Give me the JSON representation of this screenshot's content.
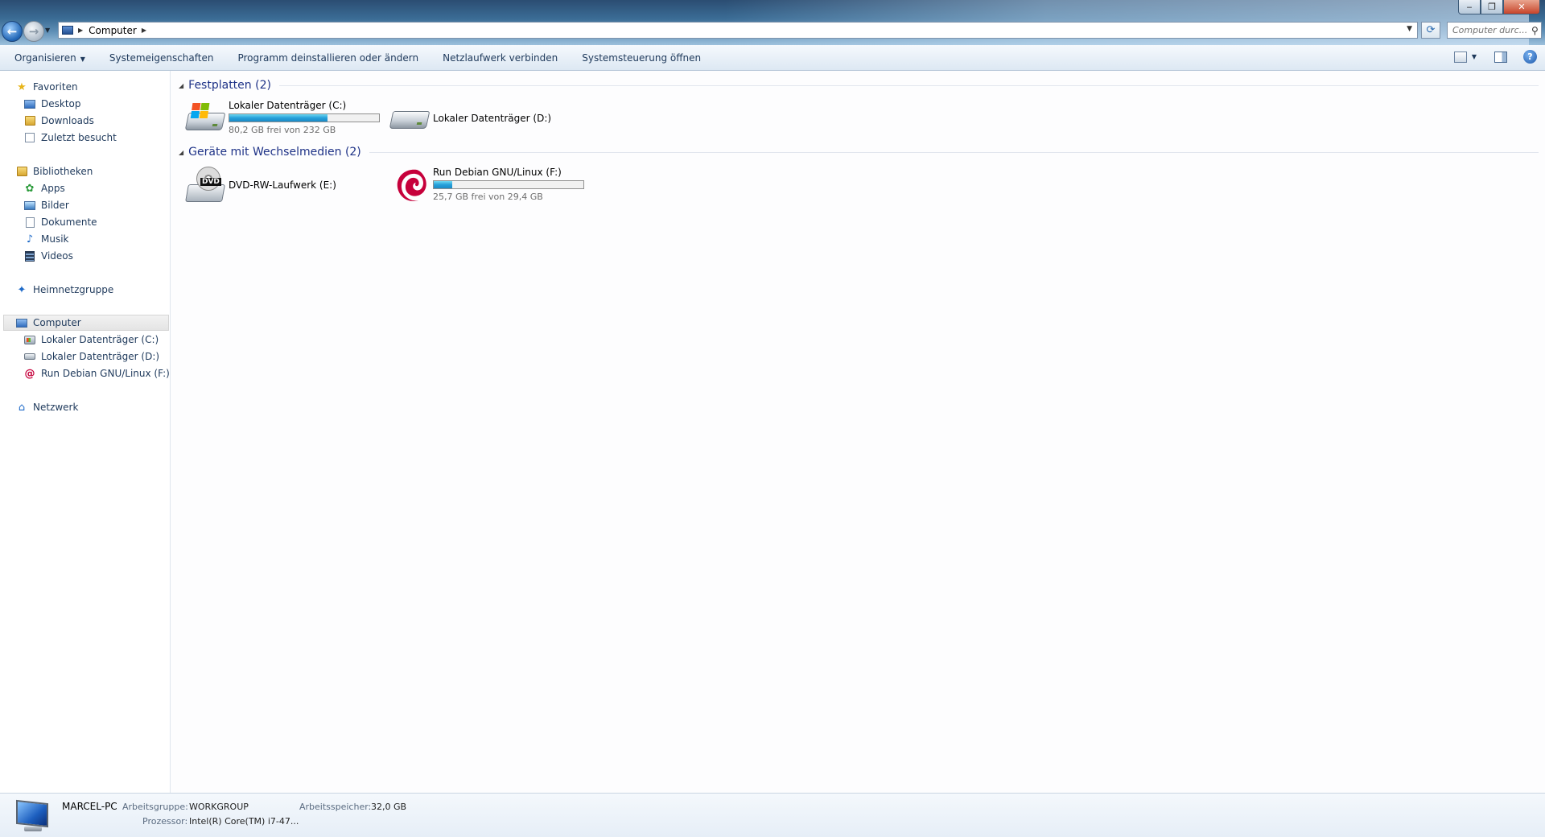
{
  "address": {
    "crumb": "Computer",
    "search_placeholder": "Computer durc..."
  },
  "toolbar": {
    "organize": "Organisieren",
    "system_properties": "Systemeigenschaften",
    "uninstall": "Programm deinstallieren oder ändern",
    "map_drive": "Netzlaufwerk verbinden",
    "control_panel": "Systemsteuerung öffnen"
  },
  "sidebar": {
    "favorites": {
      "label": "Favoriten",
      "items": [
        "Desktop",
        "Downloads",
        "Zuletzt besucht"
      ]
    },
    "libraries": {
      "label": "Bibliotheken",
      "items": [
        "Apps",
        "Bilder",
        "Dokumente",
        "Musik",
        "Videos"
      ]
    },
    "homegroup": "Heimnetzgruppe",
    "computer": {
      "label": "Computer",
      "items": [
        "Lokaler Datenträger (C:)",
        "Lokaler Datenträger (D:)",
        "Run Debian GNU/Linux (F:)"
      ]
    },
    "network": "Netzwerk"
  },
  "groups": {
    "hard_disks": {
      "title": "Festplatten (2)",
      "drives": [
        {
          "name": "Lokaler Datenträger (C:)",
          "free_text": "80,2 GB frei von 232 GB",
          "used_fraction": 0.654
        },
        {
          "name": "Lokaler Datenträger (D:)"
        }
      ]
    },
    "removable": {
      "title": "Geräte mit Wechselmedien (2)",
      "drives": [
        {
          "name": "DVD-RW-Laufwerk (E:)",
          "icon_label": "DVD"
        },
        {
          "name": "Run Debian GNU/Linux (F:)",
          "free_text": "25,7 GB frei von 29,4 GB",
          "used_fraction": 0.126
        }
      ]
    }
  },
  "details": {
    "computer_name": "MARCEL-PC",
    "workgroup_label": "Arbeitsgruppe:",
    "workgroup_value": "WORKGROUP",
    "memory_label": "Arbeitsspeicher:",
    "memory_value": "32,0 GB",
    "processor_label": "Prozessor:",
    "processor_value": "Intel(R) Core(TM) i7-47..."
  },
  "colors": {
    "accent": "#1e3287",
    "bar_fill": "#26a0da",
    "debian": "#c6003b"
  }
}
